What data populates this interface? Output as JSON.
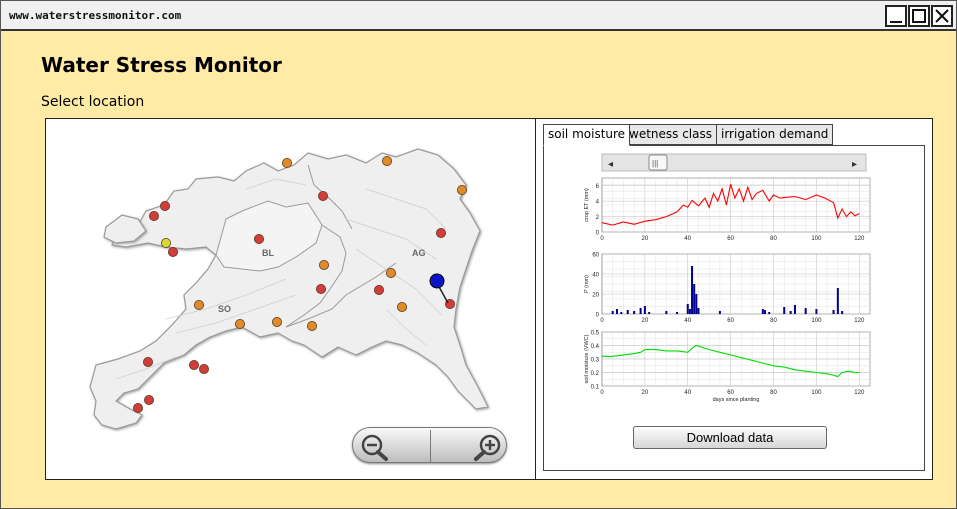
{
  "window": {
    "url": "www.waterstressmonitor.com",
    "controls": [
      "minimize",
      "maximize",
      "close"
    ]
  },
  "app": {
    "title": "Water Stress Monitor",
    "select_label": "Select location"
  },
  "map": {
    "regions": [
      {
        "label": "BL"
      },
      {
        "label": "SO"
      },
      {
        "label": "AG"
      }
    ],
    "zoom_out_icon": "zoom-out-icon",
    "zoom_in_icon": "zoom-in-icon",
    "marker_colors": {
      "orange": "#e08a2a",
      "red": "#d23c3c",
      "yellow": "#d8d83a",
      "pin": "#0a14c8"
    }
  },
  "tabs": [
    {
      "label": "soil moisture",
      "active": true
    },
    {
      "label": "wetness class",
      "active": false
    },
    {
      "label": "irrigation demand",
      "active": false
    }
  ],
  "slider": {
    "left_arrow": "◂",
    "right_arrow": "▸",
    "thumb": "|||"
  },
  "chart_data": [
    {
      "type": "line",
      "ylabel": "crop ET (mm)",
      "xlim": [
        0,
        125
      ],
      "ylim": [
        0,
        7
      ],
      "xticks": [
        0,
        20,
        40,
        60,
        80,
        100,
        120
      ],
      "yticks": [
        0,
        2,
        4,
        6
      ],
      "color": "#ff0000",
      "x": [
        0,
        5,
        10,
        15,
        20,
        25,
        30,
        35,
        38,
        40,
        42,
        45,
        48,
        50,
        52,
        54,
        56,
        58,
        60,
        62,
        64,
        66,
        68,
        70,
        72,
        75,
        78,
        80,
        83,
        86,
        90,
        95,
        100,
        104,
        108,
        110,
        112,
        114,
        116,
        118,
        120
      ],
      "values": [
        1.2,
        0.9,
        1.3,
        1.0,
        1.4,
        1.6,
        2.0,
        2.6,
        3.5,
        3.2,
        4.1,
        3.4,
        4.4,
        3.2,
        5.0,
        4.0,
        5.6,
        3.5,
        6.2,
        4.4,
        5.6,
        4.0,
        5.8,
        4.2,
        5.0,
        5.4,
        4.0,
        4.8,
        4.4,
        4.5,
        4.6,
        4.2,
        4.8,
        4.4,
        3.8,
        1.8,
        3.0,
        2.0,
        2.6,
        2.1,
        2.4
      ]
    },
    {
      "type": "bar",
      "ylabel": "P (mm)",
      "xlim": [
        0,
        125
      ],
      "ylim": [
        0,
        60
      ],
      "xticks": [
        0,
        20,
        40,
        60,
        80,
        100,
        120
      ],
      "yticks": [
        0,
        20,
        40,
        60
      ],
      "color": "#00008b",
      "x": [
        5,
        7,
        9,
        12,
        15,
        18,
        20,
        22,
        30,
        35,
        40,
        41,
        42,
        43,
        44,
        45,
        55,
        75,
        76,
        78,
        85,
        88,
        90,
        95,
        100,
        108,
        110,
        112
      ],
      "values": [
        3,
        5,
        2,
        4,
        3,
        6,
        8,
        2,
        3,
        2,
        10,
        5,
        48,
        30,
        20,
        6,
        3,
        5,
        4,
        2,
        7,
        3,
        9,
        6,
        5,
        4,
        26,
        3
      ]
    },
    {
      "type": "line",
      "ylabel": "soil moisture (VWC)",
      "xlabel": "days since planting",
      "xlim": [
        0,
        125
      ],
      "ylim": [
        0.1,
        0.5
      ],
      "xticks": [
        0,
        20,
        40,
        60,
        80,
        100,
        120
      ],
      "yticks": [
        0.1,
        0.2,
        0.3,
        0.4,
        0.5
      ],
      "color": "#00dd00",
      "x": [
        0,
        5,
        10,
        15,
        18,
        20,
        25,
        30,
        35,
        40,
        42,
        44,
        50,
        55,
        60,
        65,
        70,
        75,
        80,
        85,
        90,
        95,
        100,
        105,
        108,
        110,
        112,
        115,
        118,
        120
      ],
      "values": [
        0.32,
        0.32,
        0.33,
        0.34,
        0.35,
        0.37,
        0.37,
        0.36,
        0.36,
        0.35,
        0.38,
        0.4,
        0.37,
        0.35,
        0.33,
        0.31,
        0.29,
        0.27,
        0.25,
        0.24,
        0.22,
        0.21,
        0.2,
        0.19,
        0.18,
        0.17,
        0.2,
        0.21,
        0.2,
        0.2
      ]
    }
  ],
  "download_label": "Download data"
}
